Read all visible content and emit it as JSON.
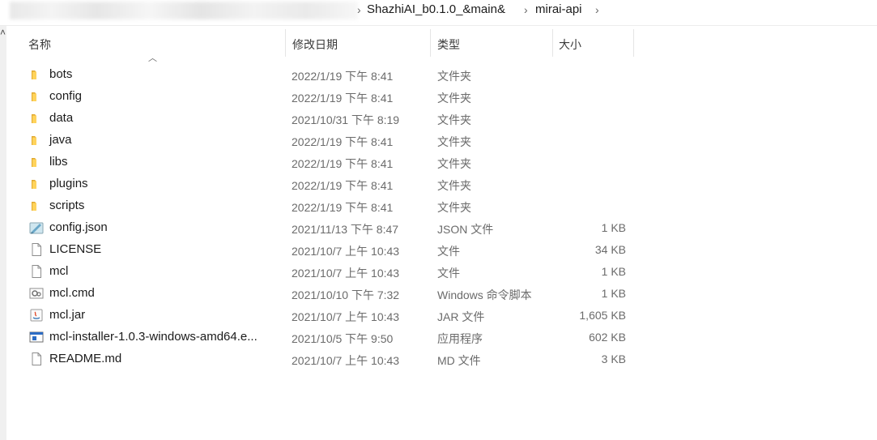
{
  "breadcrumb": {
    "items": [
      "ShazhiAI_b0.1.0_&main&",
      "mirai-api"
    ]
  },
  "columns": {
    "name": "名称",
    "date": "修改日期",
    "type": "类型",
    "size": "大小"
  },
  "files": [
    {
      "name": "bots",
      "date": "2022/1/19 下午 8:41",
      "type": "文件夹",
      "size": "",
      "icon": "folder-icon"
    },
    {
      "name": "config",
      "date": "2022/1/19 下午 8:41",
      "type": "文件夹",
      "size": "",
      "icon": "folder-icon"
    },
    {
      "name": "data",
      "date": "2021/10/31 下午 8:19",
      "type": "文件夹",
      "size": "",
      "icon": "folder-icon"
    },
    {
      "name": "java",
      "date": "2022/1/19 下午 8:41",
      "type": "文件夹",
      "size": "",
      "icon": "folder-icon"
    },
    {
      "name": "libs",
      "date": "2022/1/19 下午 8:41",
      "type": "文件夹",
      "size": "",
      "icon": "folder-icon"
    },
    {
      "name": "plugins",
      "date": "2022/1/19 下午 8:41",
      "type": "文件夹",
      "size": "",
      "icon": "folder-icon"
    },
    {
      "name": "scripts",
      "date": "2022/1/19 下午 8:41",
      "type": "文件夹",
      "size": "",
      "icon": "folder-icon"
    },
    {
      "name": "config.json",
      "date": "2021/11/13 下午 8:47",
      "type": "JSON 文件",
      "size": "1 KB",
      "icon": "json-file-icon"
    },
    {
      "name": "LICENSE",
      "date": "2021/10/7 上午 10:43",
      "type": "文件",
      "size": "34 KB",
      "icon": "file-icon"
    },
    {
      "name": "mcl",
      "date": "2021/10/7 上午 10:43",
      "type": "文件",
      "size": "1 KB",
      "icon": "file-icon"
    },
    {
      "name": "mcl.cmd",
      "date": "2021/10/10 下午 7:32",
      "type": "Windows 命令脚本",
      "size": "1 KB",
      "icon": "cmd-script-icon"
    },
    {
      "name": "mcl.jar",
      "date": "2021/10/7 上午 10:43",
      "type": "JAR 文件",
      "size": "1,605 KB",
      "icon": "java-jar-icon"
    },
    {
      "name": "mcl-installer-1.0.3-windows-amd64.e...",
      "date": "2021/10/5 下午 9:50",
      "type": "应用程序",
      "size": "602 KB",
      "icon": "application-icon"
    },
    {
      "name": "README.md",
      "date": "2021/10/7 上午 10:43",
      "type": "MD 文件",
      "size": "3 KB",
      "icon": "file-icon"
    }
  ]
}
